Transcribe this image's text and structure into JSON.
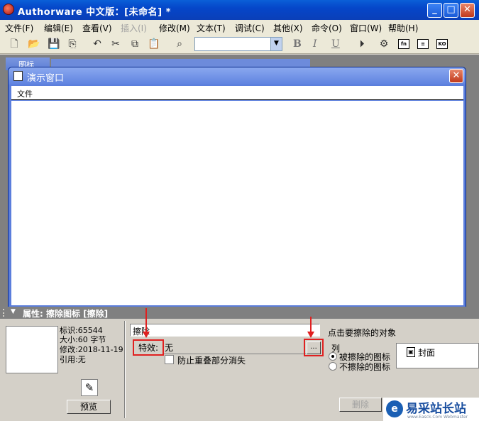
{
  "window": {
    "title": "Authorware 中文版：[未命名] *"
  },
  "menubar": [
    {
      "label": "文件(F)",
      "disabled": false
    },
    {
      "label": "编辑(E)",
      "disabled": false
    },
    {
      "label": "查看(V)",
      "disabled": false
    },
    {
      "label": "插入(I)",
      "disabled": true
    },
    {
      "label": "修改(M)",
      "disabled": false
    },
    {
      "label": "文本(T)",
      "disabled": false
    },
    {
      "label": "调试(C)",
      "disabled": false
    },
    {
      "label": "其他(X)",
      "disabled": false
    },
    {
      "label": "命令(O)",
      "disabled": false
    },
    {
      "label": "窗口(W)",
      "disabled": false
    },
    {
      "label": "帮助(H)",
      "disabled": false
    }
  ],
  "toolbar": {
    "font_combo_value": "",
    "bold": "B",
    "italic": "I",
    "underline": "U",
    "fn_label": "fn",
    "ko_label": "KO"
  },
  "behind_window": {
    "title": "图标"
  },
  "presentation": {
    "title": "演示窗口",
    "menu_file": "文件"
  },
  "properties": {
    "header": "属性: 擦除图标 [擦除]",
    "id_line": "标识:65544",
    "size_line": "大小:60 字节",
    "modified_line": "修改:2018-11-19",
    "ref_line": "引用:无",
    "preview_button": "预览",
    "name_value": "擦除",
    "effect_label": "特效:",
    "effect_value": "无",
    "effect_browse": "...",
    "prevent_overlap_label": "防止重叠部分消失",
    "hint": "点击要擦除的对象",
    "list_label": "列",
    "radio_erased": "被擦除的图标",
    "radio_not_erased": "不擦除的图标",
    "list_item": "封面",
    "delete_button": "删除"
  },
  "watermark": {
    "text": "易采站长站",
    "url": "www.Easck.Com Webmaster"
  },
  "colors": {
    "titlebar": "#0546c9",
    "annotation": "#e02020",
    "panel": "#d4d0c8"
  }
}
